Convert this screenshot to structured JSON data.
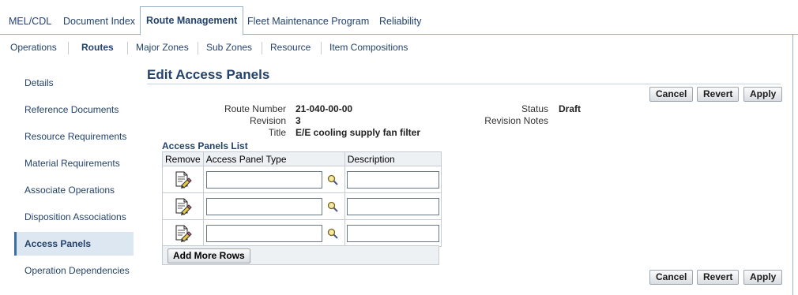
{
  "tabs": [
    {
      "label": "MEL/CDL"
    },
    {
      "label": "Document Index"
    },
    {
      "label": "Route Management"
    },
    {
      "label": "Fleet Maintenance Program"
    },
    {
      "label": "Reliability"
    }
  ],
  "active_tab": "Route Management",
  "subtabs": [
    {
      "label": "Operations"
    },
    {
      "label": "Routes"
    },
    {
      "label": "Major Zones"
    },
    {
      "label": "Sub Zones"
    },
    {
      "label": "Resource"
    },
    {
      "label": "Item Compositions"
    }
  ],
  "active_subtab": "Routes",
  "sidenav": [
    {
      "label": "Details"
    },
    {
      "label": "Reference Documents"
    },
    {
      "label": "Resource Requirements"
    },
    {
      "label": "Material Requirements"
    },
    {
      "label": "Associate Operations"
    },
    {
      "label": "Disposition Associations"
    },
    {
      "label": "Access Panels"
    },
    {
      "label": "Operation Dependencies"
    }
  ],
  "active_sidenav": "Access Panels",
  "page": {
    "title": "Edit Access Panels",
    "buttons": {
      "cancel": "Cancel",
      "revert": "Revert",
      "apply": "Apply"
    }
  },
  "details": {
    "route_number_label": "Route Number",
    "route_number": "21-040-00-00",
    "revision_label": "Revision",
    "revision": "3",
    "title_label": "Title",
    "title": "E/E cooling supply fan filter",
    "status_label": "Status",
    "status": "Draft",
    "revision_notes_label": "Revision Notes",
    "revision_notes": ""
  },
  "panels_list": {
    "title": "Access Panels List",
    "columns": [
      "Remove",
      "Access Panel Type",
      "Description"
    ],
    "rows": [
      {
        "type": "",
        "description": ""
      },
      {
        "type": "",
        "description": ""
      },
      {
        "type": "",
        "description": ""
      }
    ],
    "add_more_label": "Add More Rows"
  },
  "icons": {
    "remove": "remove-document-icon",
    "search": "search-lens-icon"
  },
  "colors": {
    "link": "#24436b",
    "active_nav_bg": "#dde7f2",
    "active_nav_bar": "#3c6ea6"
  }
}
